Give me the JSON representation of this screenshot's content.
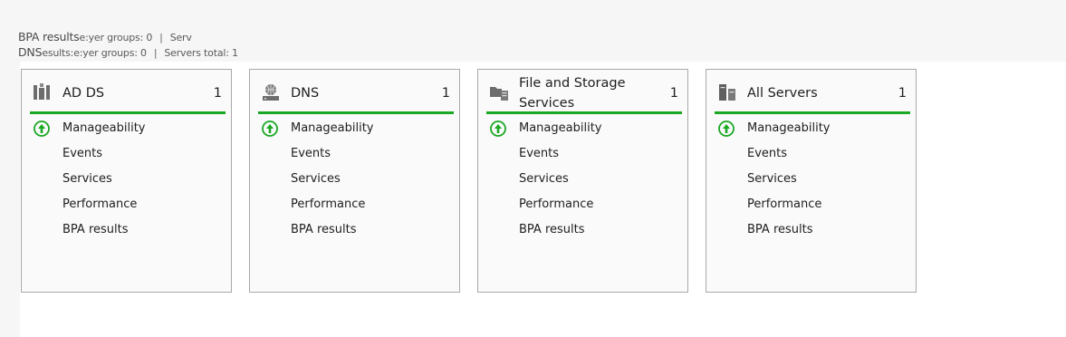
{
  "summary": {
    "line1": {
      "lead": "BPA results",
      "text": "e:yer groups: 0",
      "sep": "|",
      "tail": "Serv"
    },
    "line2": {
      "lead": "DNS",
      "text": "esults:e:yer groups: 0",
      "sep": "|",
      "tail": "Servers total: 1"
    }
  },
  "tiles": [
    {
      "title": "AD DS",
      "count": "1",
      "icon": "ad-ds-icon",
      "rows": [
        "Manageability",
        "Events",
        "Services",
        "Performance",
        "BPA results"
      ],
      "status_icon": "status-ok-arrow-up-icon"
    },
    {
      "title": "DNS",
      "count": "1",
      "icon": "dns-server-icon",
      "rows": [
        "Manageability",
        "Events",
        "Services",
        "Performance",
        "BPA results"
      ],
      "status_icon": "status-ok-arrow-up-icon"
    },
    {
      "title": "File and Storage Services",
      "count": "1",
      "icon": "file-storage-icon",
      "rows": [
        "Manageability",
        "Events",
        "Services",
        "Performance",
        "BPA results"
      ],
      "status_icon": "status-ok-arrow-up-icon"
    },
    {
      "title": "All Servers",
      "count": "1",
      "icon": "all-servers-icon",
      "rows": [
        "Manageability",
        "Events",
        "Services",
        "Performance",
        "BPA results"
      ],
      "status_icon": "status-ok-arrow-up-icon"
    }
  ],
  "colors": {
    "status_green": "#1aa825",
    "tile_border": "#a9a9a9",
    "icon_gray": "#6d6d6d"
  }
}
